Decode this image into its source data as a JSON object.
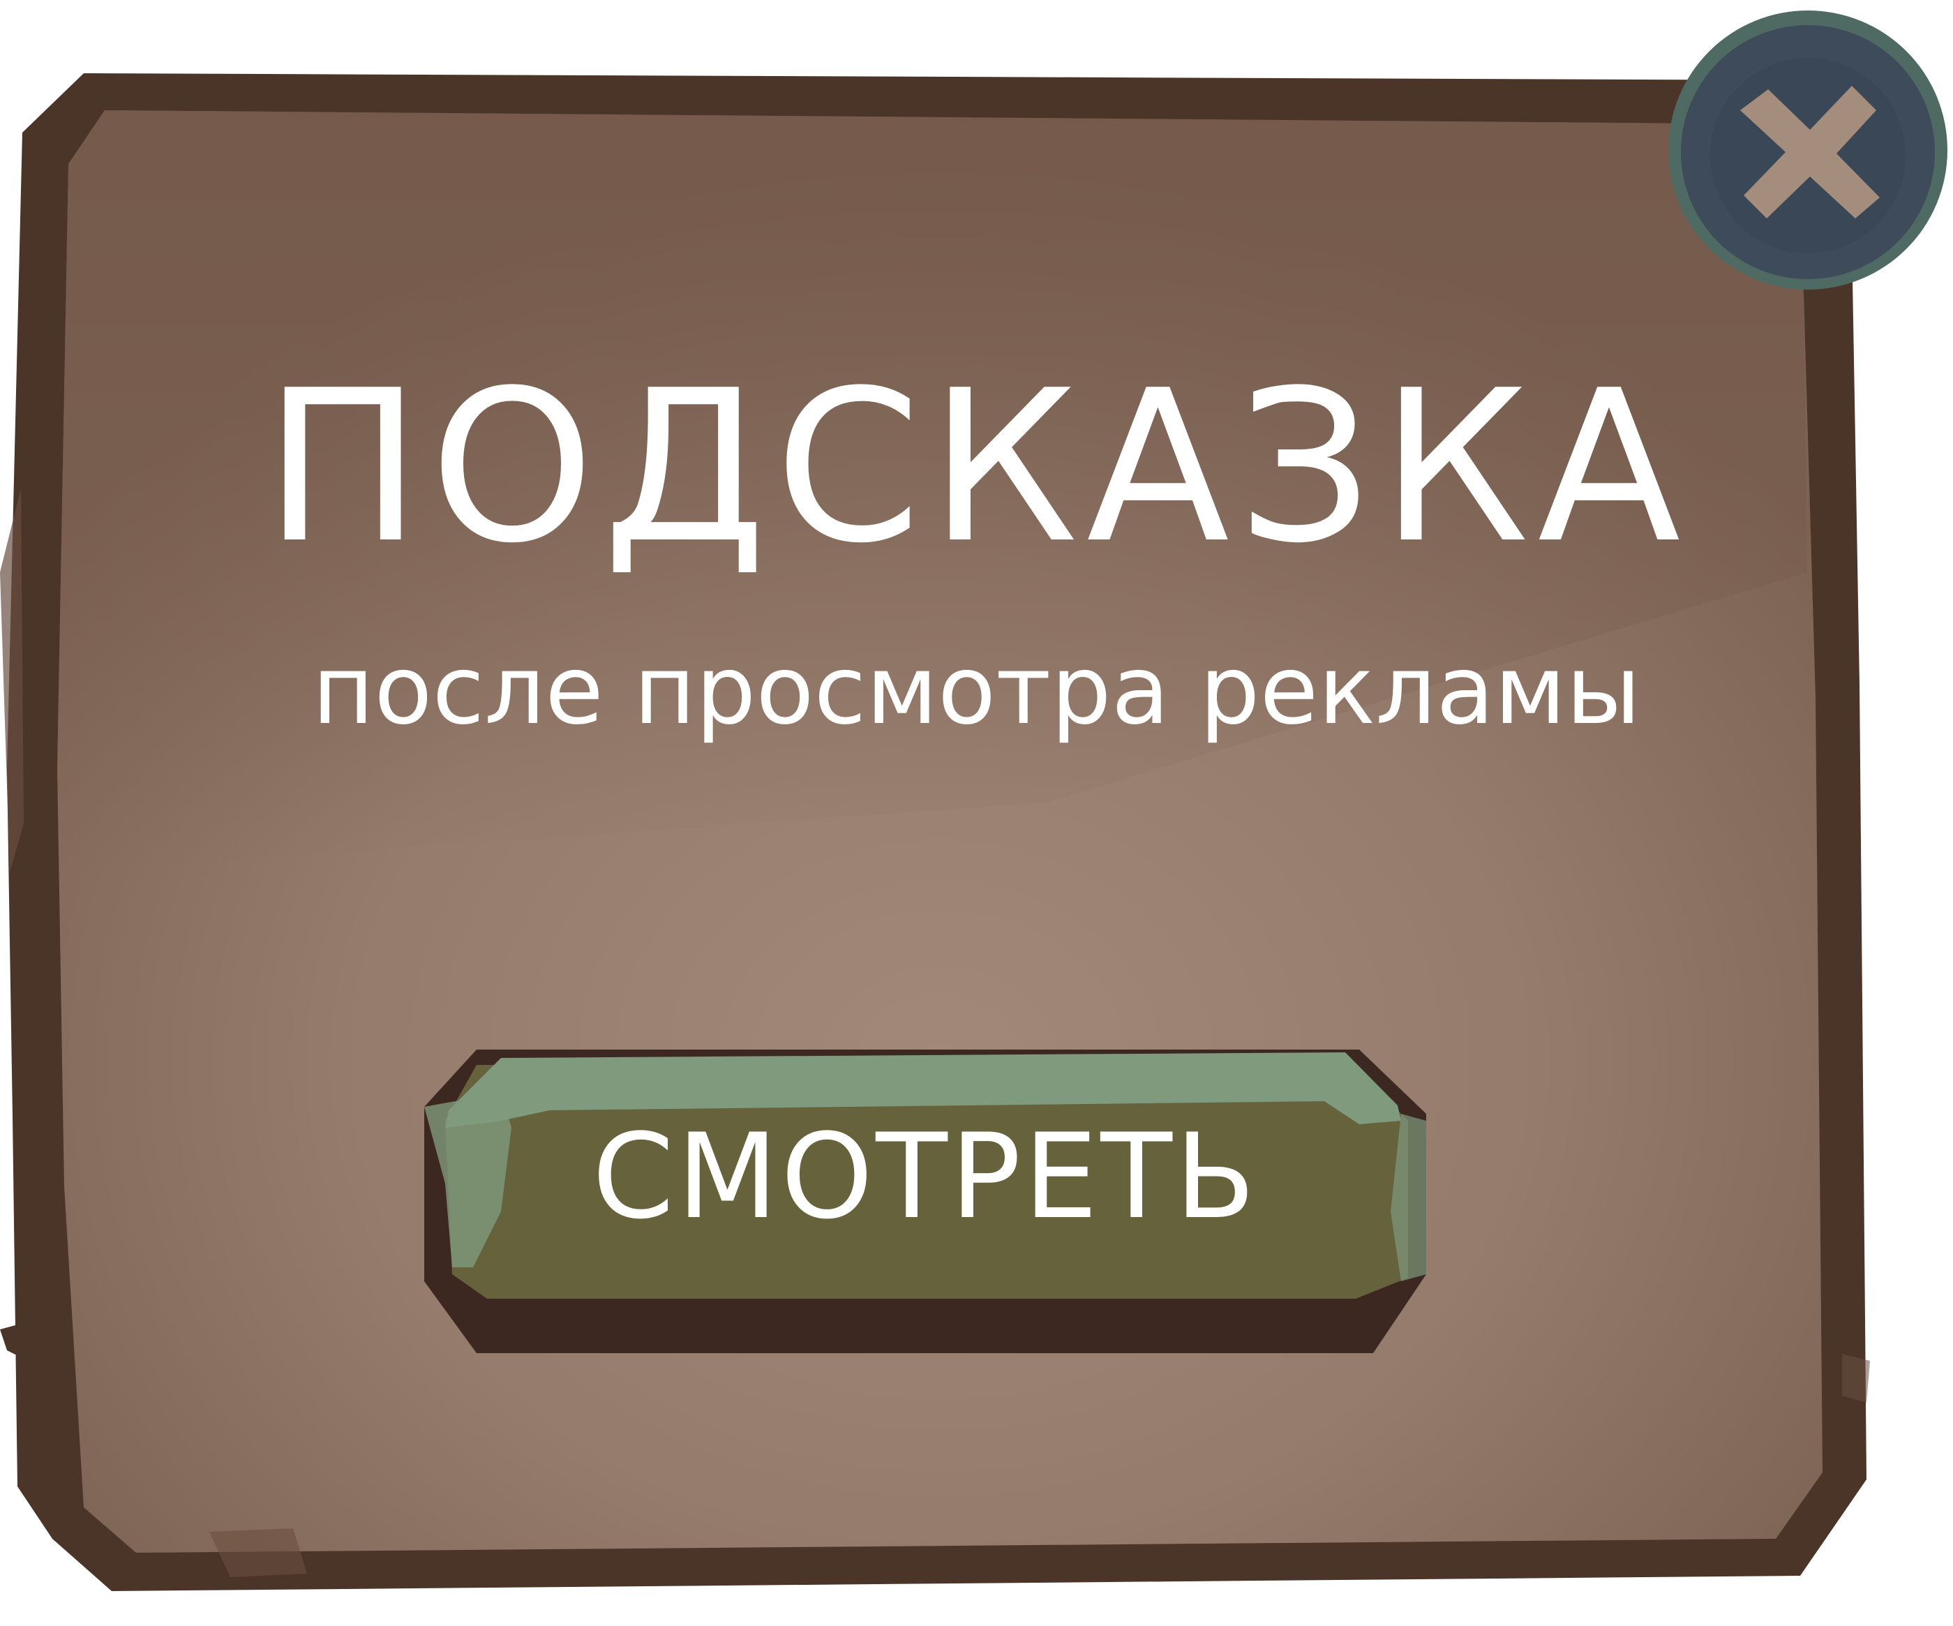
{
  "dialog": {
    "title": "ПОДСКАЗКА",
    "subtitle": "после просмотра рекламы",
    "watch_button_label": "СМОТРЕТЬ",
    "close_icon": "close-icon"
  },
  "colors": {
    "panel_fill": "#8a6e5e",
    "panel_border": "#4b3529",
    "button_face": "#66633c",
    "button_highlight": "#7f9a7d",
    "button_shadow": "#3c2820",
    "close_fill": "#3e4b5a",
    "close_cross": "#a58d7d",
    "text": "#ffffff"
  }
}
